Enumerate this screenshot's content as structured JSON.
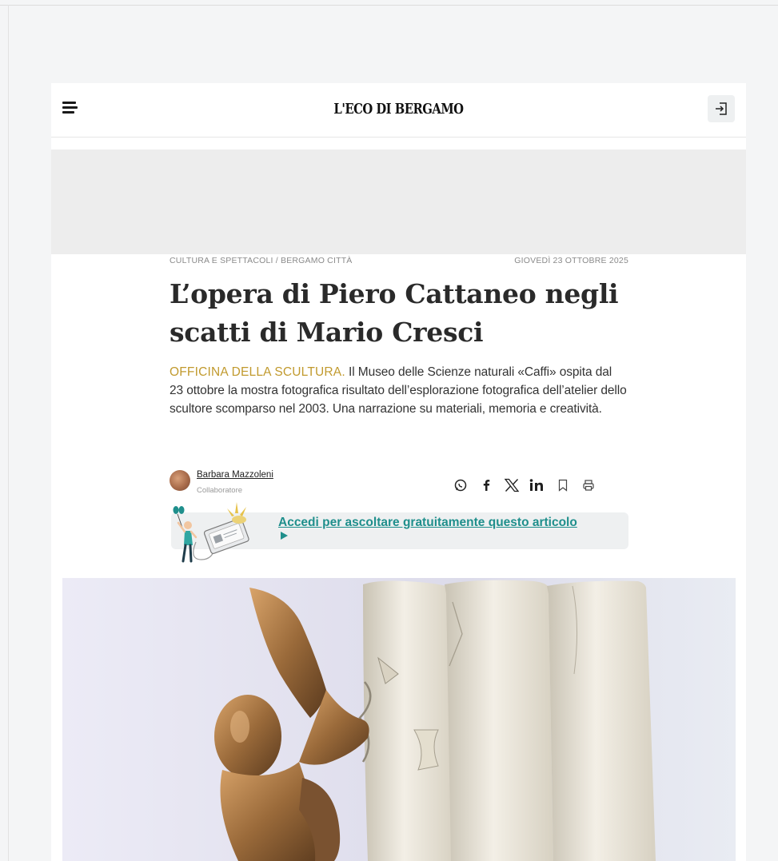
{
  "header": {
    "menu_icon": "hamburger-menu-icon",
    "logo_text": "L'ECO DI BERGAMO",
    "login_icon": "login-arrow-icon"
  },
  "article": {
    "section": "CULTURA E SPETTACOLI / BERGAMO CITTÀ",
    "date": "GIOVEDÌ 23 OTTOBRE 2025",
    "title": "L’opera di Piero Cattaneo negli scatti di Mario Cresci",
    "kicker": "OFFICINA DELLA SCULTURA.",
    "summary": " Il Museo delle Scienze naturali «Caffi» ospita dal 23 ottobre la mostra fotografica risultato dell’esplorazione fotografica dell’atelier dello scultore scomparso nel 2003. Una narrazione su materiali, memoria e creatività.",
    "author": {
      "name": "Barbara Mazzoleni",
      "role": "Collaboratore"
    },
    "share_icons": [
      "whatsapp-icon",
      "facebook-icon",
      "x-icon",
      "linkedin-icon",
      "bookmark-icon",
      "print-icon"
    ],
    "audio_cta": "Accedi per ascoltare gratuitamente questo articolo"
  },
  "colors": {
    "kicker": "#c19a2e",
    "audio_link": "#1f8f8c",
    "ad_background": "#ededed"
  }
}
